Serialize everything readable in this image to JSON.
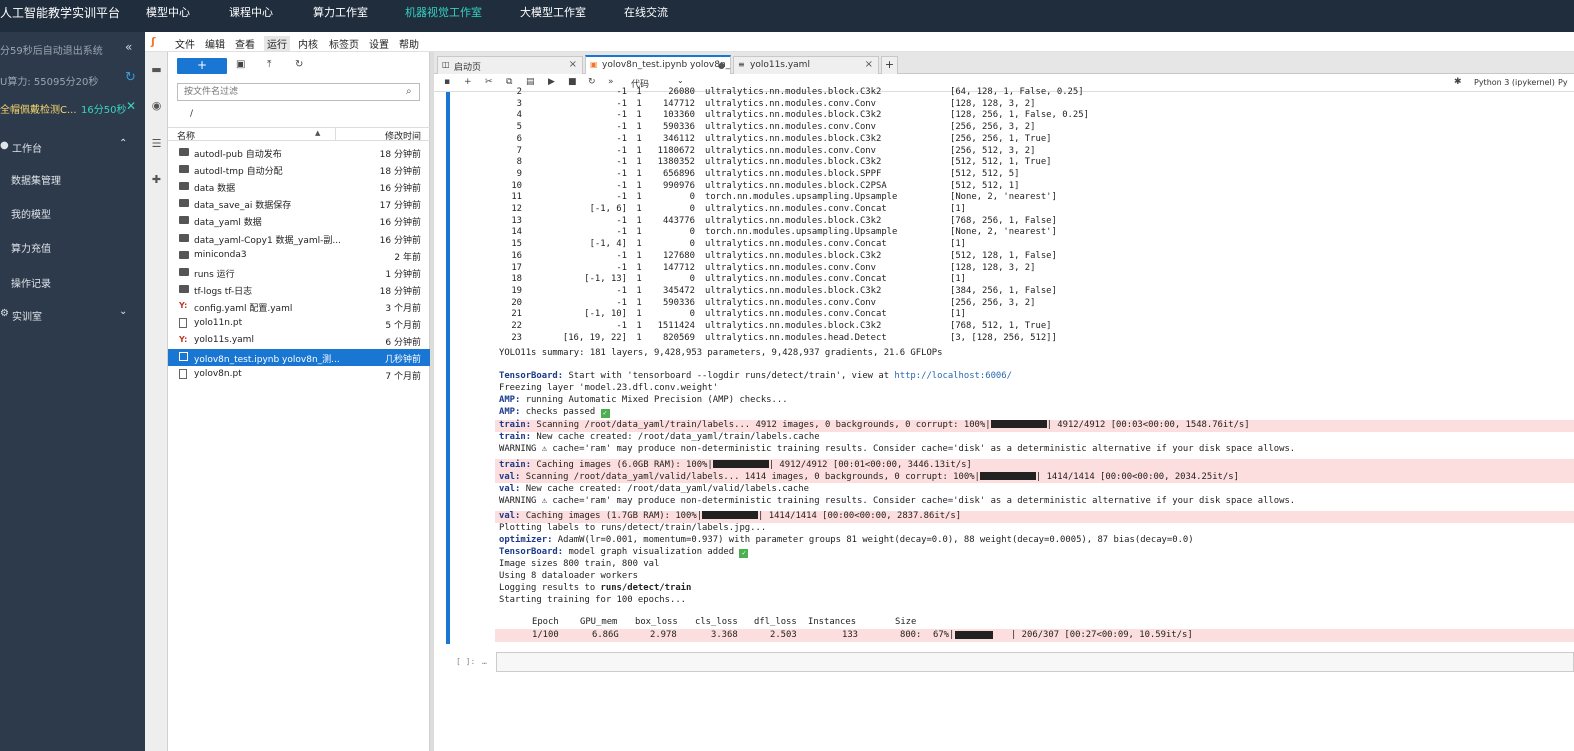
{
  "top_nav": {
    "brand": "人工智能教学实训平台",
    "items": [
      "模型中心",
      "课程中心",
      "算力工作室",
      "机器视觉工作室",
      "大模型工作室",
      "在线交流"
    ],
    "active": "机器视觉工作室"
  },
  "left_panel": {
    "logout_notice": "分59秒后自动退出系统",
    "compute": "U算力: 55095分20秒",
    "task_name": "全帽佩戴检测C...",
    "task_time": "16分50秒",
    "section_workbench": "工作台",
    "items": [
      "数据集管理",
      "我的模型",
      "算力充值",
      "操作记录"
    ],
    "section_lab": "实训室"
  },
  "menubar": [
    "文件",
    "编辑",
    "查看",
    "运行",
    "内核",
    "标签页",
    "设置",
    "帮助"
  ],
  "file_browser": {
    "filter_placeholder": "按文件名过滤",
    "breadcrumb": "/",
    "col_name": "名称",
    "col_modified": "修改时间",
    "files": [
      {
        "name": "autodl-pub  自动发布",
        "time": "18 分钟前",
        "type": "folder"
      },
      {
        "name": "autodl-tmp  自动分配",
        "time": "18 分钟前",
        "type": "folder"
      },
      {
        "name": "data  数据",
        "time": "16 分钟前",
        "type": "folder"
      },
      {
        "name": "data_save_ai  数据保存",
        "time": "17 分钟前",
        "type": "folder"
      },
      {
        "name": "data_yaml  数据",
        "time": "16 分钟前",
        "type": "folder"
      },
      {
        "name": "data_yaml-Copy1  数据_yaml-副...",
        "time": "16 分钟前",
        "type": "folder"
      },
      {
        "name": "miniconda3",
        "time": "2 年前",
        "type": "folder"
      },
      {
        "name": "runs  运行",
        "time": "1 分钟前",
        "type": "folder"
      },
      {
        "name": "tf-logs  tf-日志",
        "time": "18 分钟前",
        "type": "folder"
      },
      {
        "name": "config.yaml  配置.yaml",
        "time": "3 个月前",
        "type": "yaml"
      },
      {
        "name": "yolo11n.pt",
        "time": "5 个月前",
        "type": "file"
      },
      {
        "name": "yolo11s.yaml",
        "time": "6 分钟前",
        "type": "yaml"
      },
      {
        "name": "yolov8n_test.ipynb  yolov8n_测...",
        "time": "几秒钟前",
        "type": "notebook",
        "selected": true
      },
      {
        "name": "yolov8n.pt",
        "time": "7 个月前",
        "type": "file"
      }
    ]
  },
  "tabs": [
    {
      "label": "启动页"
    },
    {
      "label": "yolov8n_test.ipynb  yolov8n_",
      "active": true
    },
    {
      "label": "yolo11s.yaml"
    }
  ],
  "notebook_toolbar": {
    "cell_type": "代码",
    "kernel": "Python 3 (ipykernel)",
    "kernel_tail": "Py"
  },
  "model_table": [
    [
      "2",
      "-1",
      "1",
      "26080",
      "ultralytics.nn.modules.block.C3k2",
      "[64, 128, 1, False, 0.25]"
    ],
    [
      "3",
      "-1",
      "1",
      "147712",
      "ultralytics.nn.modules.conv.Conv",
      "[128, 128, 3, 2]"
    ],
    [
      "4",
      "-1",
      "1",
      "103360",
      "ultralytics.nn.modules.block.C3k2",
      "[128, 256, 1, False, 0.25]"
    ],
    [
      "5",
      "-1",
      "1",
      "590336",
      "ultralytics.nn.modules.conv.Conv",
      "[256, 256, 3, 2]"
    ],
    [
      "6",
      "-1",
      "1",
      "346112",
      "ultralytics.nn.modules.block.C3k2",
      "[256, 256, 1, True]"
    ],
    [
      "7",
      "-1",
      "1",
      "1180672",
      "ultralytics.nn.modules.conv.Conv",
      "[256, 512, 3, 2]"
    ],
    [
      "8",
      "-1",
      "1",
      "1380352",
      "ultralytics.nn.modules.block.C3k2",
      "[512, 512, 1, True]"
    ],
    [
      "9",
      "-1",
      "1",
      "656896",
      "ultralytics.nn.modules.block.SPPF",
      "[512, 512, 5]"
    ],
    [
      "10",
      "-1",
      "1",
      "990976",
      "ultralytics.nn.modules.block.C2PSA",
      "[512, 512, 1]"
    ],
    [
      "11",
      "-1",
      "1",
      "0",
      "torch.nn.modules.upsampling.Upsample",
      "[None, 2, 'nearest']"
    ],
    [
      "12",
      "[-1, 6]",
      "1",
      "0",
      "ultralytics.nn.modules.conv.Concat",
      "[1]"
    ],
    [
      "13",
      "-1",
      "1",
      "443776",
      "ultralytics.nn.modules.block.C3k2",
      "[768, 256, 1, False]"
    ],
    [
      "14",
      "-1",
      "1",
      "0",
      "torch.nn.modules.upsampling.Upsample",
      "[None, 2, 'nearest']"
    ],
    [
      "15",
      "[-1, 4]",
      "1",
      "0",
      "ultralytics.nn.modules.conv.Concat",
      "[1]"
    ],
    [
      "16",
      "-1",
      "1",
      "127680",
      "ultralytics.nn.modules.block.C3k2",
      "[512, 128, 1, False]"
    ],
    [
      "17",
      "-1",
      "1",
      "147712",
      "ultralytics.nn.modules.conv.Conv",
      "[128, 128, 3, 2]"
    ],
    [
      "18",
      "[-1, 13]",
      "1",
      "0",
      "ultralytics.nn.modules.conv.Concat",
      "[1]"
    ],
    [
      "19",
      "-1",
      "1",
      "345472",
      "ultralytics.nn.modules.block.C3k2",
      "[384, 256, 1, False]"
    ],
    [
      "20",
      "-1",
      "1",
      "590336",
      "ultralytics.nn.modules.conv.Conv",
      "[256, 256, 3, 2]"
    ],
    [
      "21",
      "[-1, 10]",
      "1",
      "0",
      "ultralytics.nn.modules.conv.Concat",
      "[1]"
    ],
    [
      "22",
      "-1",
      "1",
      "1511424",
      "ultralytics.nn.modules.block.C3k2",
      "[768, 512, 1, True]"
    ],
    [
      "23",
      "[16, 19, 22]",
      "1",
      "820569",
      "ultralytics.nn.modules.head.Detect",
      "[3, [128, 256, 512]]"
    ]
  ],
  "output": {
    "summary": "YOLO11s summary: 181 layers, 9,428,953 parameters, 9,428,937 gradients, 21.6 GFLOPs",
    "tb_label": "TensorBoard:",
    "tb_text": " Start with 'tensorboard --logdir runs/detect/train', view at ",
    "tb_link": "http://localhost:6006/",
    "freezing": "Freezing layer 'model.23.dfl.conv.weight'",
    "amp_label": "AMP:",
    "amp1": " running Automatic Mixed Precision (AMP) checks...",
    "amp2": " checks passed",
    "train_label": "train:",
    "train_scan": " Scanning /root/data_yaml/train/labels... 4912 images, 0 backgrounds, 0 corrupt: 100%|",
    "train_scan_end": "| 4912/4912 [00:03<00:00, 1548.76it/s]",
    "train_cache": " New cache created: /root/data_yaml/train/labels.cache",
    "warning1": "WARNING ⚠ cache='ram' may produce non-deterministic training results. Consider cache='disk' as a deterministic alternative if your disk space allows.",
    "train_caching": " Caching images (6.0GB RAM): 100%|",
    "train_caching_end": "| 4912/4912 [00:01<00:00, 3446.13it/s]",
    "val_label": "val:",
    "val_scan": " Scanning /root/data_yaml/valid/labels... 1414 images, 0 backgrounds, 0 corrupt: 100%|",
    "val_scan_end": "| 1414/1414 [00:00<00:00, 2034.25it/s]",
    "val_cache": " New cache created: /root/data_yaml/valid/labels.cache",
    "warning2": "WARNING ⚠ cache='ram' may produce non-deterministic training results. Consider cache='disk' as a deterministic alternative if your disk space allows.",
    "val_caching": " Caching images (1.7GB RAM): 100%|",
    "val_caching_end": "| 1414/1414 [00:00<00:00, 2837.86it/s]",
    "plotting": "Plotting labels to runs/detect/train/labels.jpg...",
    "opt_label": "optimizer:",
    "opt_text": " AdamW(lr=0.001, momentum=0.937) with parameter groups 81 weight(decay=0.0), 88 weight(decay=0.0005), 87 bias(decay=0.0)",
    "tb2_text": " model graph visualization added",
    "img_sizes": "Image sizes 800 train, 800 val",
    "workers": "Using 8 dataloader workers",
    "logging_prefix": "Logging results to ",
    "logging_path": "runs/detect/train",
    "starting": "Starting training for 100 epochs..."
  },
  "epoch_header": [
    "Epoch",
    "GPU_mem",
    "box_loss",
    "cls_loss",
    "dfl_loss",
    "Instances",
    "Size"
  ],
  "epoch_row": {
    "epoch": "1/100",
    "gpu": "6.86G",
    "box": "2.978",
    "cls": "3.368",
    "dfl": "2.503",
    "inst": "133",
    "size": "800:",
    "pct": "67%|",
    "progress": 0.67,
    "rest": "| 206/307 [00:27<00:09, 10.59it/s]"
  },
  "next_cell_prompt": "[ ]:"
}
